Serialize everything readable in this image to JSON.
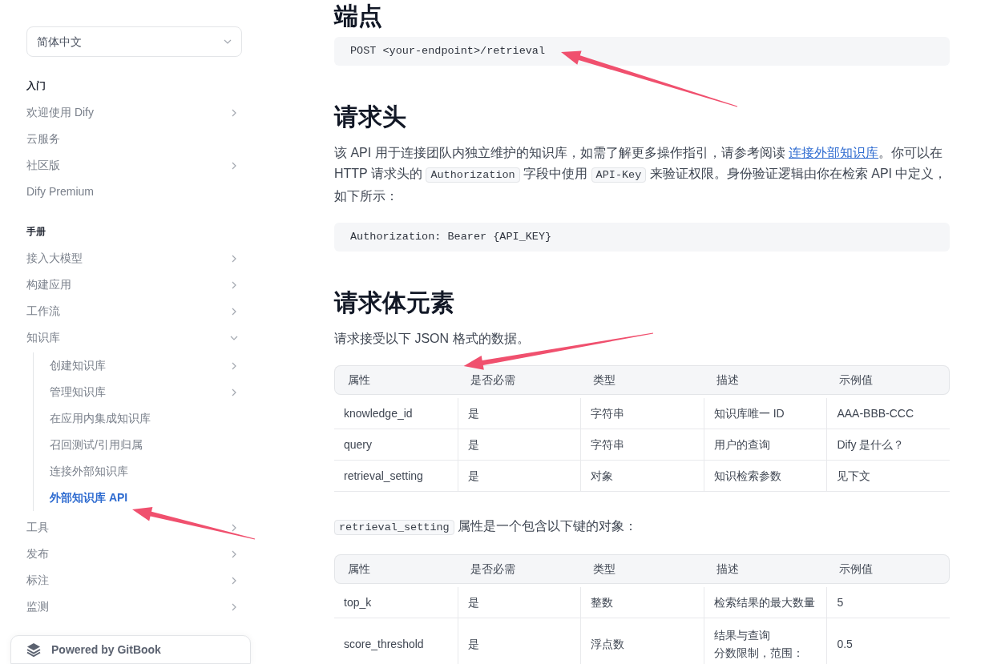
{
  "language_select": {
    "value": "简体中文"
  },
  "sidebar": {
    "sections": [
      {
        "title": "入门",
        "items": [
          {
            "label": "欢迎使用 Dify",
            "selected": false,
            "expanded": false
          },
          {
            "label": "云服务",
            "selected": false
          },
          {
            "label": "社区版",
            "selected": false,
            "expanded": false
          },
          {
            "label": "Dify Premium",
            "selected": false
          }
        ]
      },
      {
        "title": "手册",
        "items": [
          {
            "label": "接入大模型",
            "selected": false,
            "expanded": false
          },
          {
            "label": "构建应用",
            "selected": false,
            "expanded": false
          },
          {
            "label": "工作流",
            "selected": false,
            "expanded": false
          },
          {
            "label": "知识库",
            "selected": false,
            "expanded": true,
            "children": [
              {
                "label": "创建知识库",
                "selected": false,
                "expanded": false
              },
              {
                "label": "管理知识库",
                "selected": false,
                "expanded": false
              },
              {
                "label": "在应用内集成知识库",
                "selected": false
              },
              {
                "label": "召回测试/引用归属",
                "selected": false
              },
              {
                "label": "连接外部知识库",
                "selected": false
              },
              {
                "label": "外部知识库 API",
                "selected": true
              }
            ]
          },
          {
            "label": "工具",
            "selected": false,
            "expanded": false
          },
          {
            "label": "发布",
            "selected": false,
            "expanded": false
          },
          {
            "label": "标注",
            "selected": false,
            "expanded": false
          },
          {
            "label": "监测",
            "selected": false,
            "expanded": false
          }
        ]
      }
    ],
    "footer": "Powered by GitBook"
  },
  "content": [
    {
      "kind": "heading",
      "text": "端点"
    },
    {
      "kind": "code",
      "text": "POST <your-endpoint>/retrieval"
    },
    {
      "kind": "heading",
      "text": "请求头"
    },
    {
      "kind": "paragraph",
      "parts": [
        {
          "kind": "text",
          "text": "该 API 用于连接团队内独立维护的知识库，如需了解更多操作指引，请参考阅读 "
        },
        {
          "kind": "link",
          "text": "连接外部知识库"
        },
        {
          "kind": "text",
          "text": "。你可以在 HTTP 请求头的 "
        },
        {
          "kind": "code",
          "text": "Authorization"
        },
        {
          "kind": "text",
          "text": " 字段中使用 "
        },
        {
          "kind": "code",
          "text": "API-Key"
        },
        {
          "kind": "text",
          "text": " 来验证权限。身份验证逻辑由你在检索 API 中定义，如下所示："
        }
      ]
    },
    {
      "kind": "code",
      "text": "Authorization: Bearer {API_KEY}"
    },
    {
      "kind": "heading",
      "text": "请求体元素"
    },
    {
      "kind": "paragraph",
      "parts": [
        {
          "kind": "text",
          "text": "请求接受以下 JSON 格式的数据。"
        }
      ]
    },
    {
      "kind": "table",
      "columns": [
        "属性",
        "是否必需",
        "类型",
        "描述",
        "示例值"
      ],
      "rows": [
        [
          "knowledge_id",
          "是",
          "字符串",
          "知识库唯一 ID",
          "AAA-BBB-CCC"
        ],
        [
          "query",
          "是",
          "字符串",
          "用户的查询",
          "Dify 是什么？"
        ],
        [
          "retrieval_setting",
          "是",
          "对象",
          "知识检索参数",
          "见下文"
        ]
      ]
    },
    {
      "kind": "paragraph",
      "parts": [
        {
          "kind": "code",
          "text": "retrieval_setting"
        },
        {
          "kind": "text",
          "text": " 属性是一个包含以下键的对象："
        }
      ]
    },
    {
      "kind": "table",
      "columns": [
        "属性",
        "是否必需",
        "类型",
        "描述",
        "示例值"
      ],
      "rows": [
        [
          "top_k",
          "是",
          "整数",
          "检索结果的最大数量",
          "5"
        ],
        [
          "score_threshold",
          "是",
          "浮点数",
          [
            "结果与查询",
            "分数限制，范围："
          ],
          "0.5"
        ]
      ]
    }
  ]
}
